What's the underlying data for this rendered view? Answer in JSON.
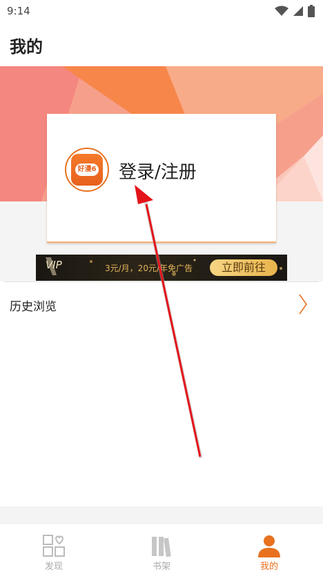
{
  "status_bar": {
    "time": "9:14"
  },
  "page": {
    "title": "我的"
  },
  "login_card": {
    "logo_text": "好漫6",
    "label": "登录/注册"
  },
  "vip_banner": {
    "logo": "VIP",
    "promo_text": "3元/月，20元/年免广告",
    "button_label": "立即前往"
  },
  "history": {
    "label": "历史浏览"
  },
  "bottom_nav": {
    "items": [
      {
        "label": "发现",
        "icon": "discover-grid-icon",
        "active": false
      },
      {
        "label": "书架",
        "icon": "bookshelf-icon",
        "active": false
      },
      {
        "label": "我的",
        "icon": "person-icon",
        "active": true
      }
    ]
  },
  "colors": {
    "accent": "#e8711f",
    "banner_pink": "#f59a8e",
    "banner_orange": "#f7864a",
    "vip_gold": "#e9b44c"
  }
}
